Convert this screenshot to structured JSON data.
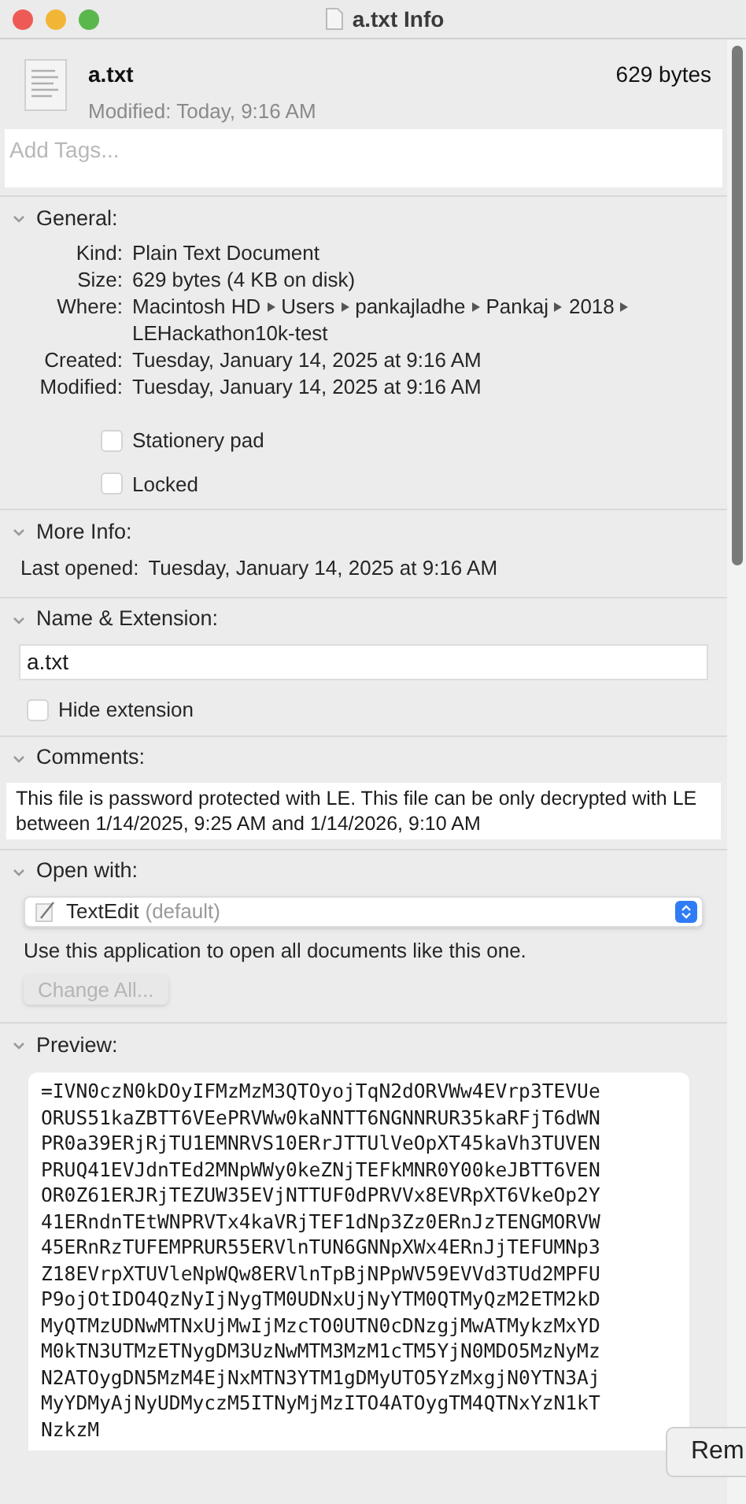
{
  "window": {
    "title": "a.txt Info"
  },
  "header": {
    "name": "a.txt",
    "size": "629 bytes",
    "modified": "Modified: Today, 9:16 AM"
  },
  "tags": {
    "placeholder": "Add Tags..."
  },
  "sections": [
    {
      "kind": "general",
      "title": "General:",
      "expanded": true,
      "rows": [
        {
          "label": "Kind:",
          "value": "Plain Text Document"
        },
        {
          "label": "Size:",
          "value": "629 bytes (4 KB on disk)"
        },
        {
          "label": "Where:",
          "path": [
            "Macintosh HD",
            "Users",
            "pankajladhe",
            "Pankaj",
            "2018",
            "LEHackathon10k-test"
          ]
        },
        {
          "label": "Created:",
          "value": "Tuesday, January 14, 2025 at 9:16 AM"
        },
        {
          "label": "Modified:",
          "value": "Tuesday, January 14, 2025 at 9:16 AM"
        }
      ],
      "checkboxes": [
        {
          "label": "Stationery pad",
          "checked": false
        },
        {
          "label": "Locked",
          "checked": false
        }
      ]
    },
    {
      "kind": "more",
      "title": "More Info:",
      "expanded": true,
      "label": "Last opened:",
      "value": "Tuesday, January 14, 2025 at 9:16 AM"
    },
    {
      "kind": "name",
      "title": "Name & Extension:",
      "expanded": true,
      "value": "a.txt",
      "checkbox": {
        "label": "Hide extension",
        "checked": false
      }
    },
    {
      "kind": "comments",
      "title": "Comments:",
      "expanded": true,
      "value": "This file is password protected with LE. This file can be only decrypted with LE  between 1/14/2025, 9:25 AM and 1/14/2026, 9:10 AM"
    },
    {
      "kind": "open",
      "title": "Open with:",
      "expanded": true,
      "app": "TextEdit",
      "app_note": "(default)",
      "hint": "Use this application to open all documents like this one.",
      "button": {
        "label": "Change All...",
        "disabled": true
      }
    },
    {
      "kind": "preview",
      "title": "Preview:",
      "expanded": true,
      "lines": [
        "=IVN0czN0kDOyIFMzMzM3QTOyojTqN2dORVWw4EVrp3TEVUe",
        "ORUS51kaZBTT6VEePRVWw0kaNNTT6NGNNRUR35kaRFjT6dWN",
        "PR0a39ERjRjTU1EMNRVS10ERrJTTUlVeOpXT45kaVh3TUVEN",
        "PRUQ41EVJdnTEd2MNpWWy0keZNjTEFkMNR0Y00keJBTT6VEN",
        "OR0Z61ERJRjTEZUW35EVjNTTUF0dPRVVx8EVRpXT6VkeOp2Y",
        "41ERndnTEtWNPRVTx4kaVRjTEF1dNp3Zz0ERnJzTENGMORVW",
        "45ERnRzTUFEMPRUR55ERVlnTUN6GNNpXWx4ERnJjTEFUMNp3",
        "Z18EVrpXTUVleNpWQw8ERVlnTpBjNPpWV59EVVd3TUd2MPFU",
        "P9ojOtIDO4QzNyIjNygTM0UDNxUjNyYTM0QTMyQzM2ETM2kD",
        "MyQTMzUDNwMTNxUjMwIjMzcTO0UTN0cDNzgjMwATMykzMxYD",
        "M0kTN3UTMzETNygDM3UzNwMTM3MzM1cTM5YjN0MDO5MzNyMz",
        "N2ATOygDN5MzM4EjNxMTN3YTM1gDMyUTO5YzMxgjN0YTN3Aj",
        "MyYDMyAjNyUDMyczM5ITNyMjMzITO4ATOygTM4QTNxYzN1kT",
        "NzkzM"
      ]
    }
  ],
  "overlay_button": {
    "label": "Rem"
  }
}
